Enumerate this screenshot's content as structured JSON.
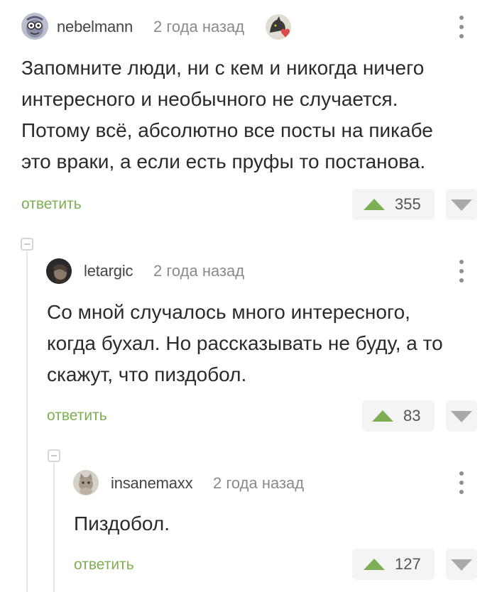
{
  "comments": [
    {
      "username": "nebelmann",
      "time": "2 года назад",
      "text_lines": [
        "Запомните люди, ни с кем и никогда ничего",
        "интересного и необычного не случается.",
        "Потому всё, абсолютно все посты на пикабе",
        "это враки, а если есть пруфы то постанова."
      ],
      "reply_label": "ответить",
      "score": "355",
      "badge_icon": "cat-heart-badge-icon"
    },
    {
      "username": "letargic",
      "time": "2 года назад",
      "text_lines": [
        "Со мной случалось много интересного,",
        "когда бухал. Но рассказывать не буду, а то",
        "скажут, что пиздобол."
      ],
      "reply_label": "ответить",
      "score": "83"
    },
    {
      "username": "insanemaxx",
      "time": "2 года назад",
      "text_lines": [
        "Пиздобол."
      ],
      "reply_label": "ответить",
      "score": "127"
    }
  ],
  "colors": {
    "accent_green": "#7dae53",
    "muted_gray": "#8a8a8a",
    "vote_bg": "#f4f4f4"
  }
}
